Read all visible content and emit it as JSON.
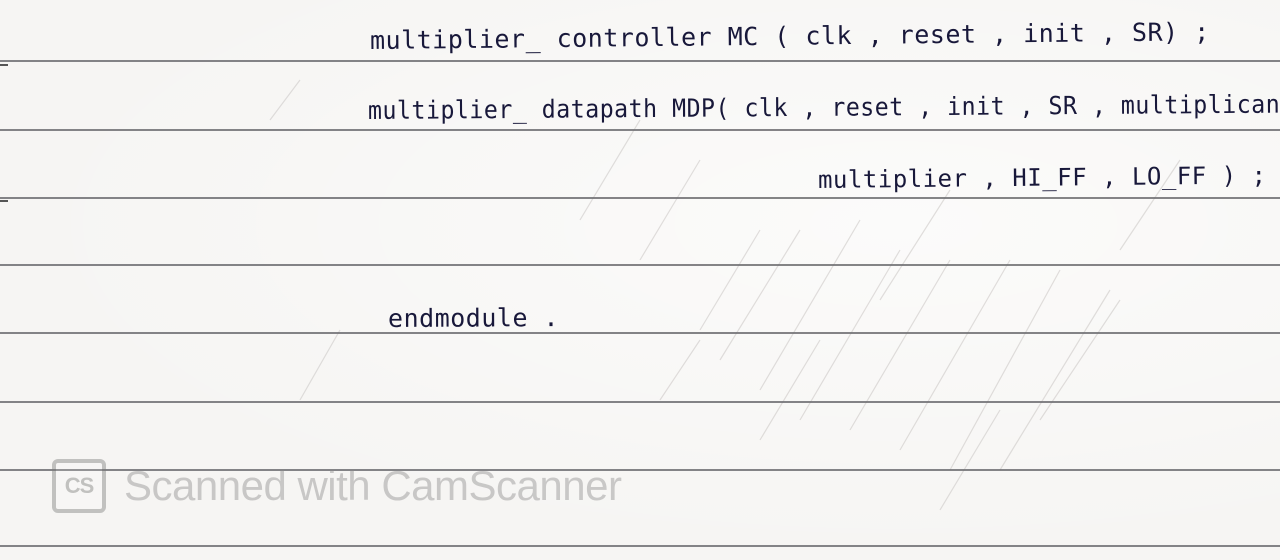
{
  "handwriting": {
    "line1": "multiplier_ controller  MC ( clk , reset , init , SR) ;",
    "line2": "multiplier_ datapath MDP( clk , reset , init , SR , multiplican",
    "line3": "multiplier , HI_FF , LO_FF ) ;",
    "line4": "endmodule ."
  },
  "watermark": {
    "logo": "CS",
    "text": "Scanned with CamScanner"
  },
  "colors": {
    "ink": "#18183a",
    "rule": "#6f6f72",
    "paper": "#f6f5f3",
    "watermark": "#8a8a8a"
  }
}
